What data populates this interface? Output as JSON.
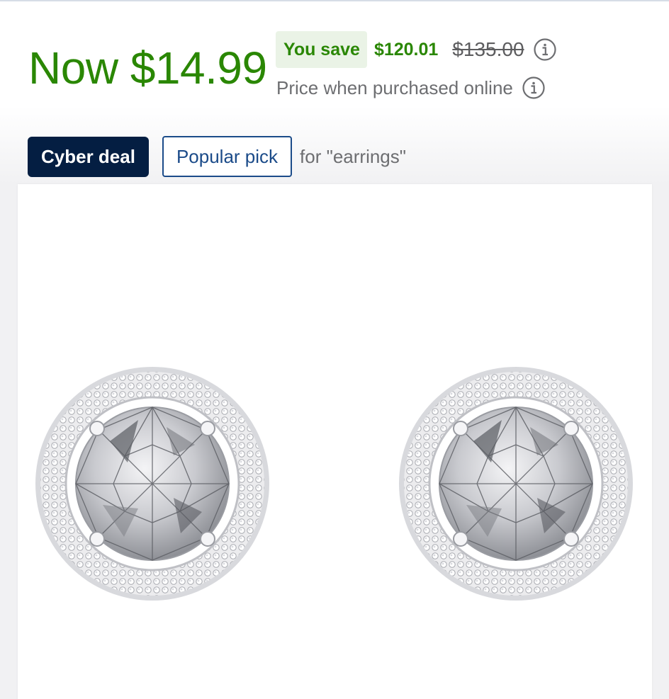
{
  "price": {
    "now": "Now $14.99",
    "you_save_label": "You save",
    "save_amount": "$120.01",
    "original_price": "$135.00",
    "online_note": "Price when purchased online",
    "price_color": "#2a8703"
  },
  "badges": {
    "cyber_deal": "Cyber deal",
    "popular_pick": "Popular pick",
    "popular_context": "for \"earrings\""
  },
  "product_image": {
    "subject": "halo stud earrings",
    "icons": [
      "info-icon",
      "info-icon"
    ]
  },
  "colors": {
    "badge_dark": "#041e42",
    "badge_outline": "#1b4b89",
    "save_bg": "#eaf3e6"
  }
}
